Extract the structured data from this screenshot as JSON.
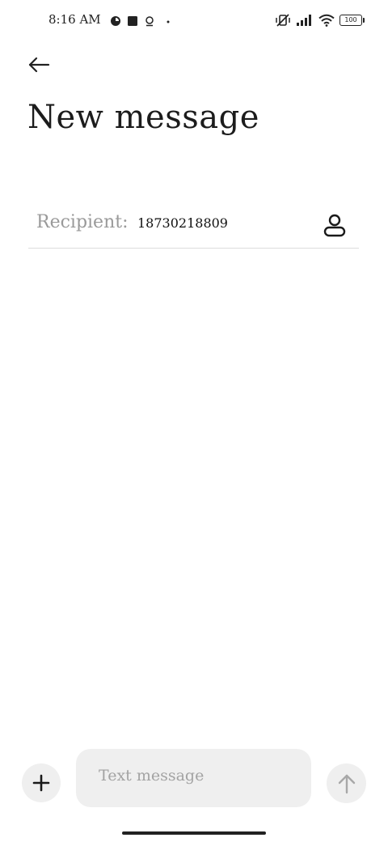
{
  "status_bar": {
    "time": "8:16 AM",
    "battery": "100"
  },
  "header": {
    "title": "New message"
  },
  "recipient": {
    "label": "Recipient:",
    "value": "18730218809"
  },
  "compose": {
    "placeholder": "Text message"
  },
  "icons": {
    "back": "arrow-left-icon",
    "contact": "person-icon",
    "add": "plus-icon",
    "send": "arrow-up-icon"
  },
  "colors": {
    "background": "#ffffff",
    "surface": "#efefef",
    "text": "#1a1a1a",
    "muted": "#9a9a9a",
    "divider": "#dcdcdc"
  }
}
